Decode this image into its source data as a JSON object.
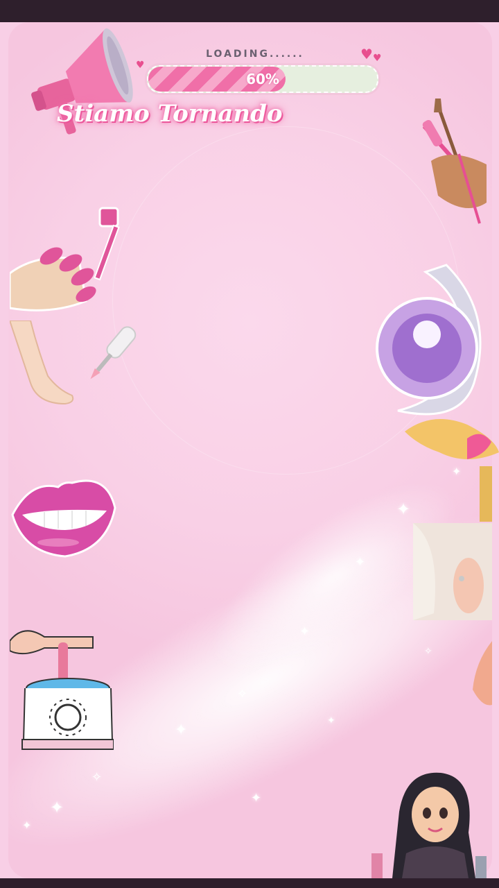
{
  "status": {
    "loading_label": "LOADING......",
    "progress_percent": 60,
    "progress_text": "60%"
  },
  "announcement": {
    "title": "Stiamo Tornando"
  },
  "icons": [
    "megaphone-icon",
    "heart-icon",
    "nail-brush-hands-icon",
    "painted-nails-icon",
    "foot-icon",
    "nail-polish-brush-icon",
    "crystal-ball-wand-icon",
    "lips-icon",
    "ear-nose-face-icon",
    "wax-warmer-icon",
    "girl-avatar-icon"
  ],
  "colors": {
    "background": "#f9d0e6",
    "accent": "#f06fa8",
    "progress_track": "#e6efdf",
    "frame": "#2e1f2c"
  }
}
